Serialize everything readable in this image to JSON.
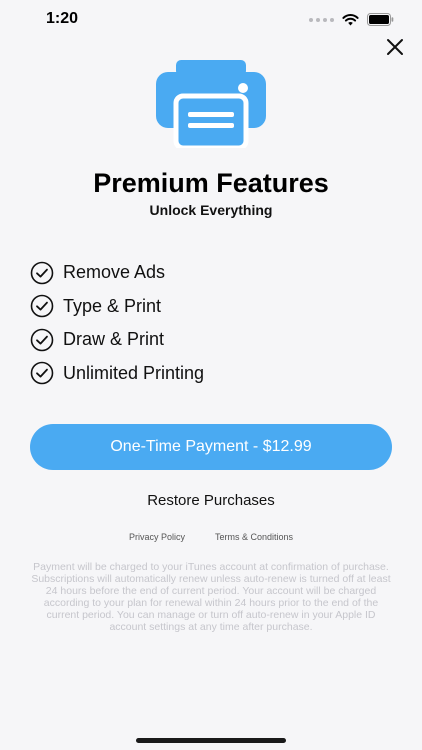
{
  "status_bar": {
    "time": "1:20",
    "icons": [
      "signal-dots-icon",
      "wifi-icon",
      "battery-icon"
    ]
  },
  "header": {
    "close_icon": "close-icon"
  },
  "hero": {
    "icon": "printer-icon",
    "title": "Premium Features",
    "subtitle": "Unlock Everything"
  },
  "features": [
    {
      "label": "Remove Ads",
      "icon": "check-circle-icon"
    },
    {
      "label": "Type & Print",
      "icon": "check-circle-icon"
    },
    {
      "label": "Draw & Print",
      "icon": "check-circle-icon"
    },
    {
      "label": "Unlimited Printing",
      "icon": "check-circle-icon"
    }
  ],
  "purchase": {
    "button_label": "One-Time Payment - $12.99",
    "restore_label": "Restore Purchases"
  },
  "links": {
    "privacy": "Privacy Policy",
    "terms": "Terms & Conditions"
  },
  "legal_text": "Payment will be charged to your iTunes account at confirmation of purchase. Subscriptions will automatically renew unless auto-renew is turned off at least 24 hours before the end of current period. Your account will be charged according to your plan for renewal within 24 hours prior to the end of the current period. You can manage or turn off auto-renew in your Apple ID account settings at any time after purchase.",
  "colors": {
    "accent": "#4aaaf2",
    "background": "#f6f6f8",
    "legal_text": "#c6c6cc"
  }
}
